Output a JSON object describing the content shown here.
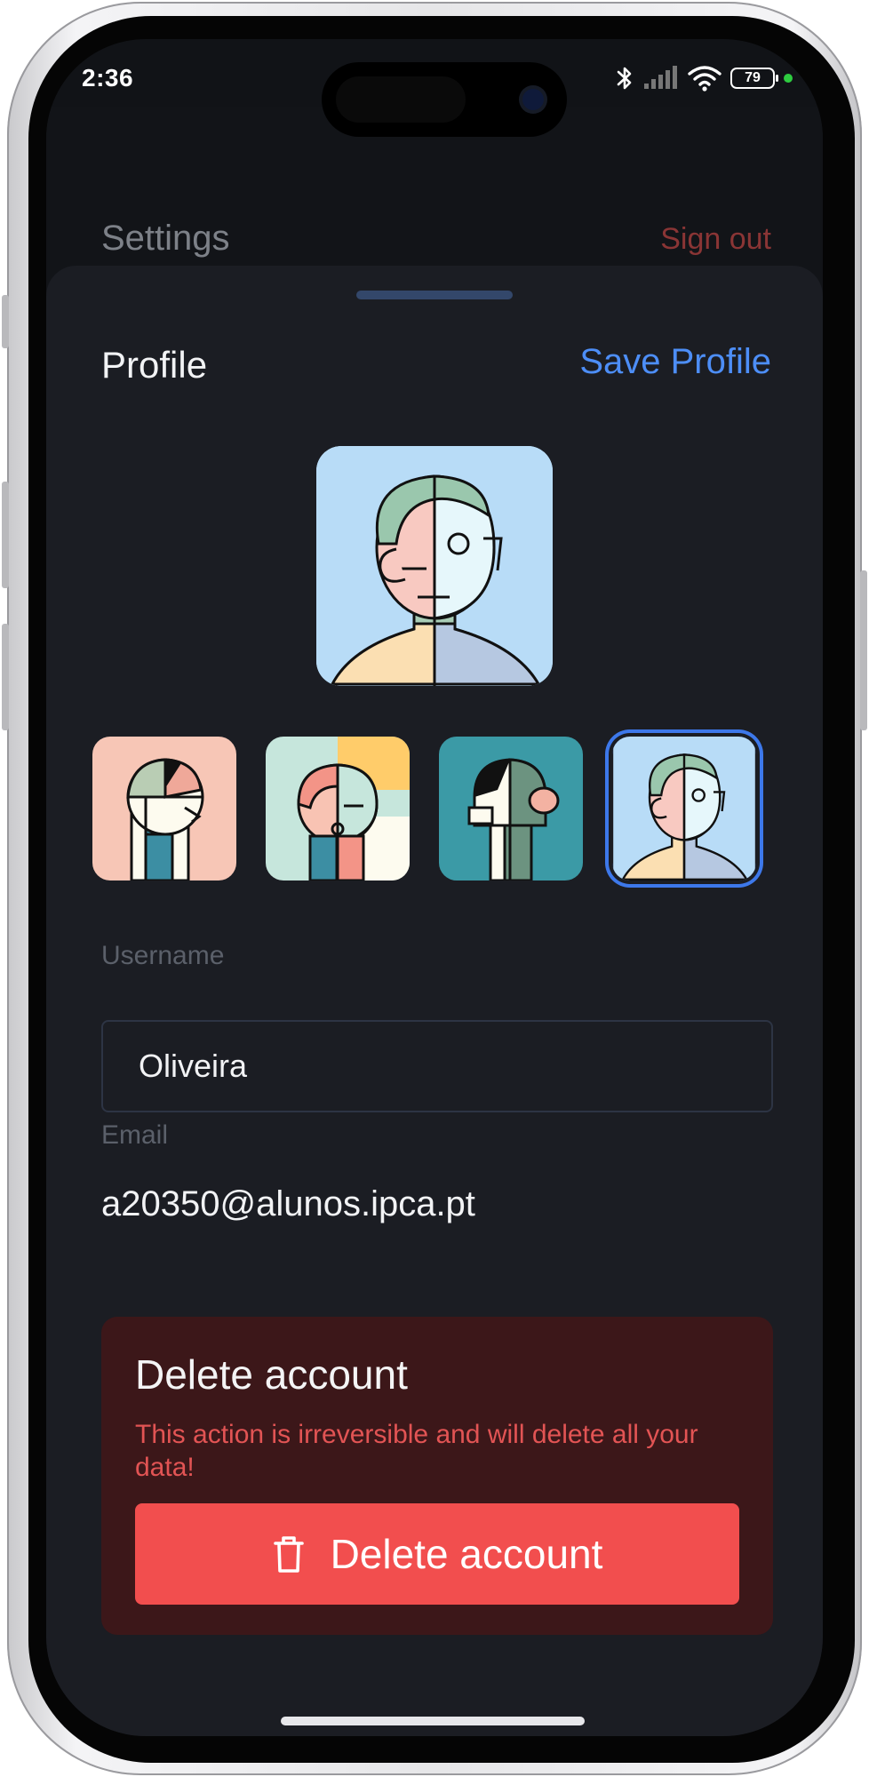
{
  "status_bar": {
    "time": "2:36",
    "battery": "79"
  },
  "page": {
    "title": "Settings",
    "sign_out_label": "Sign out"
  },
  "sheet": {
    "title": "Profile",
    "save_label": "Save Profile",
    "username": {
      "label": "Username",
      "value": "Oliveira"
    },
    "email": {
      "label": "Email",
      "value": "a20350@alunos.ipca.pt"
    },
    "avatars": {
      "selected_index": 4,
      "count": 4
    },
    "danger_zone": {
      "title": "Delete account",
      "warning": "This action is irreversible and will delete all your data!",
      "button_label": "Delete account"
    }
  },
  "colors": {
    "accent": "#4d8ef7",
    "danger": "#f24e4e",
    "danger_bg": "#3c1719",
    "sheet_bg": "#1b1d23"
  },
  "icons": [
    "bluetooth-icon",
    "cellular-signal-icon",
    "wifi-icon",
    "battery-icon",
    "trash-icon"
  ]
}
